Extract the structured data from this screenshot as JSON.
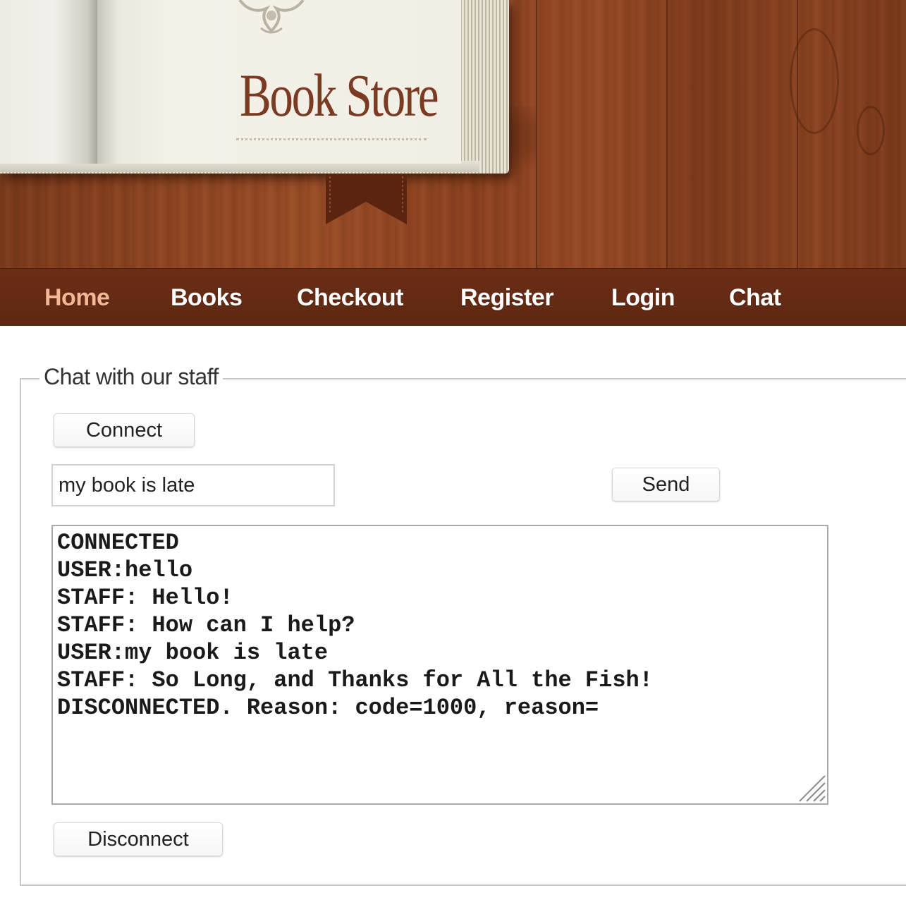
{
  "brand": {
    "title": "Book Store"
  },
  "nav": {
    "items": [
      {
        "label": "Home",
        "active": true
      },
      {
        "label": "Books",
        "active": false
      },
      {
        "label": "Checkout",
        "active": false
      },
      {
        "label": "Register",
        "active": false
      },
      {
        "label": "Login",
        "active": false
      },
      {
        "label": "Chat",
        "active": false
      }
    ]
  },
  "chat": {
    "legend": "Chat with our staff",
    "connect_label": "Connect",
    "message_input_value": "my book is late",
    "send_label": "Send",
    "log_lines": [
      "CONNECTED",
      "USER:hello",
      "STAFF: Hello!",
      "STAFF: How can I help?",
      "USER:my book is late",
      "STAFF: So Long, and Thanks for All the Fish!",
      "DISCONNECTED. Reason: code=1000, reason="
    ],
    "disconnect_label": "Disconnect"
  },
  "colors": {
    "wood": "#8e4522",
    "navbar": "#652c15",
    "nav_active": "#f2b896",
    "brand_text": "#7b3a22"
  },
  "icons": {
    "ornament": "ornament-icon",
    "bookmark": "bookmark-icon",
    "resize": "resize-grip-icon"
  }
}
